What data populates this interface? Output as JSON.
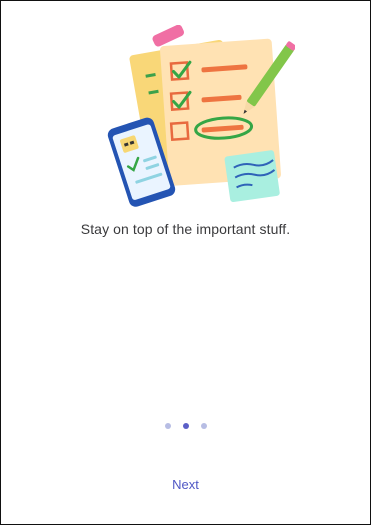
{
  "onboarding": {
    "illustration_icon": "checklist-illustration",
    "tagline": "Stay on top of the important stuff.",
    "pager": {
      "total_pages": 3,
      "current_page": 2
    },
    "next_label": "Next"
  },
  "colors": {
    "accent": "#5b5fc7",
    "dot_inactive": "#b7bde4",
    "text": "#3a3a3c"
  }
}
